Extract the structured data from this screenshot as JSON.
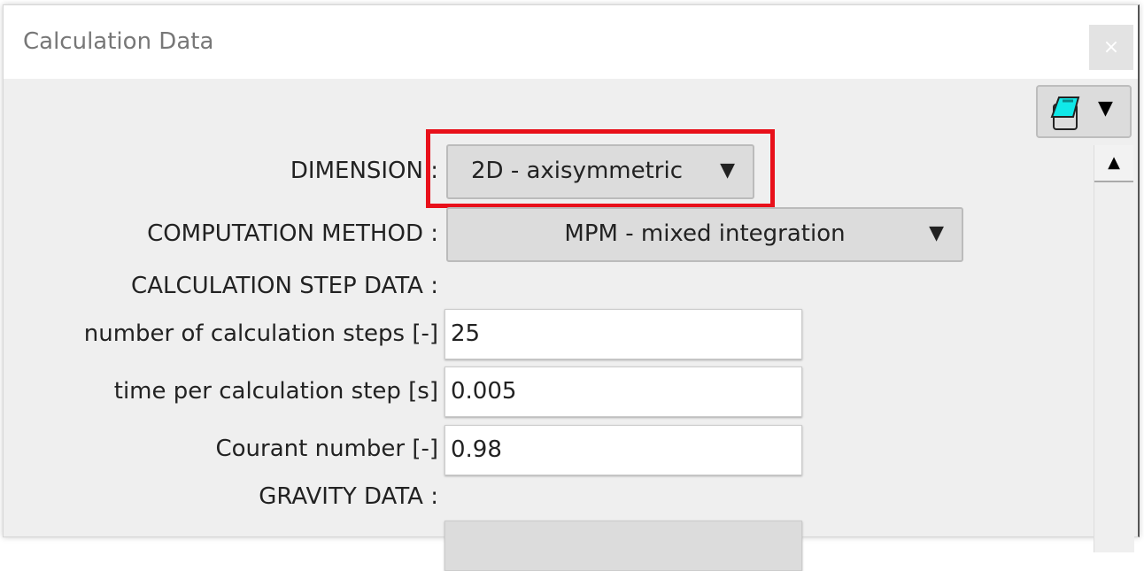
{
  "window": {
    "title": "Calculation Data",
    "close_icon": "×"
  },
  "toolbar": {
    "icon": "notebook-icon",
    "arrow": "▼"
  },
  "scrollbar": {
    "up": "▲"
  },
  "fields": {
    "dimension": {
      "label": "DIMENSION :",
      "value": "2D - axisymmetric"
    },
    "method": {
      "label": "COMPUTATION METHOD :",
      "value": "MPM - mixed integration"
    },
    "step_header": "CALCULATION STEP DATA :",
    "steps": {
      "label": "number of calculation steps [-]",
      "value": "25"
    },
    "time": {
      "label": "time per calculation step [s]",
      "value": "0.005"
    },
    "courant": {
      "label": "Courant number [-]",
      "value": "0.98"
    },
    "gravity_header": "GRAVITY DATA :"
  },
  "highlight_color": "#e8101a",
  "arrow": "▼"
}
